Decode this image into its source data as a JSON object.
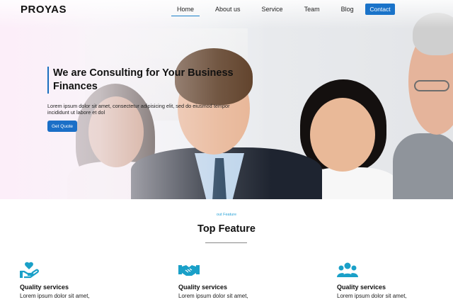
{
  "brand": {
    "logo_text": "PROYAS"
  },
  "nav": {
    "items": [
      {
        "label": "Home",
        "active": true
      },
      {
        "label": "About us",
        "active": false
      },
      {
        "label": "Service",
        "active": false
      },
      {
        "label": "Team",
        "active": false
      },
      {
        "label": "Blog",
        "active": false
      }
    ],
    "contact_label": "Contact"
  },
  "hero": {
    "title": "We are Consulting for Your Business Finances",
    "description": "Lorem ipsum dolor sit amet, consectetur adipisicing elit, sed do eiusmod tempor incididunt ut labore et dol",
    "button_label": "Get Quote"
  },
  "features": {
    "kicker": "out Feature",
    "title": "Top Feature",
    "cards": [
      {
        "icon": "hand-heart-icon",
        "title": "Quality services",
        "desc": "Lorem ipsum dolor sit amet,"
      },
      {
        "icon": "handshake-icon",
        "title": "Quality services",
        "desc": "Lorem ipsum dolor sit amet,"
      },
      {
        "icon": "users-group-icon",
        "title": "Quality services",
        "desc": "Lorem ipsum dolor sit amet,"
      }
    ]
  },
  "colors": {
    "accent": "#1a73c9",
    "icon": "#1aa0c8",
    "kicker": "#2aa3d8"
  }
}
